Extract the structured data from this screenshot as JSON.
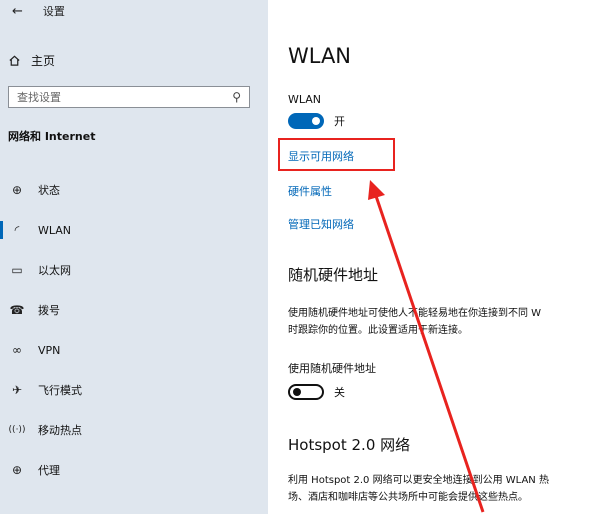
{
  "window": {
    "back_glyph": "←",
    "title": "设置"
  },
  "sidebar": {
    "home_label": "主页",
    "search_placeholder": "查找设置",
    "section_label": "网络和 Internet",
    "items": [
      {
        "icon": "globe-status-icon",
        "glyph": "⊕",
        "label": "状态"
      },
      {
        "icon": "wifi-icon",
        "glyph": "◜",
        "label": "WLAN",
        "active": true
      },
      {
        "icon": "ethernet-icon",
        "glyph": "▭",
        "label": "以太网"
      },
      {
        "icon": "dialup-icon",
        "glyph": "☎",
        "label": "拨号"
      },
      {
        "icon": "vpn-icon",
        "glyph": "∞",
        "label": "VPN"
      },
      {
        "icon": "airplane-icon",
        "glyph": "✈",
        "label": "飞行模式"
      },
      {
        "icon": "hotspot-icon",
        "glyph": "((·))",
        "label": "移动热点"
      },
      {
        "icon": "proxy-globe-icon",
        "glyph": "⊕",
        "label": "代理"
      }
    ]
  },
  "main": {
    "title": "WLAN",
    "wlan_label": "WLAN",
    "wlan_toggle": {
      "state": "开",
      "on": true
    },
    "links": {
      "show_available": "显示可用网络",
      "hardware_properties": "硬件属性",
      "manage_known": "管理已知网络"
    },
    "random_mac": {
      "heading": "随机硬件地址",
      "desc_line1": "使用随机硬件地址可使他人不能轻易地在你连接到不同 W",
      "desc_line2": "时跟踪你的位置。此设置适用于新连接。",
      "toggle_label": "使用随机硬件地址",
      "toggle_state": "关",
      "on": false
    },
    "hotspot20": {
      "heading": "Hotspot 2.0 网络",
      "desc_line1": "利用 Hotspot 2.0 网络可以更安全地连接到公用 WLAN 热",
      "desc_line2": "场、酒店和咖啡店等公共场所中可能会提供这些热点。"
    }
  },
  "annotation": {
    "color": "#e8231f"
  },
  "colors": {
    "accent": "#0067b8",
    "sidebar_bg": "#dfe6ee",
    "highlight": "#e8231f"
  }
}
